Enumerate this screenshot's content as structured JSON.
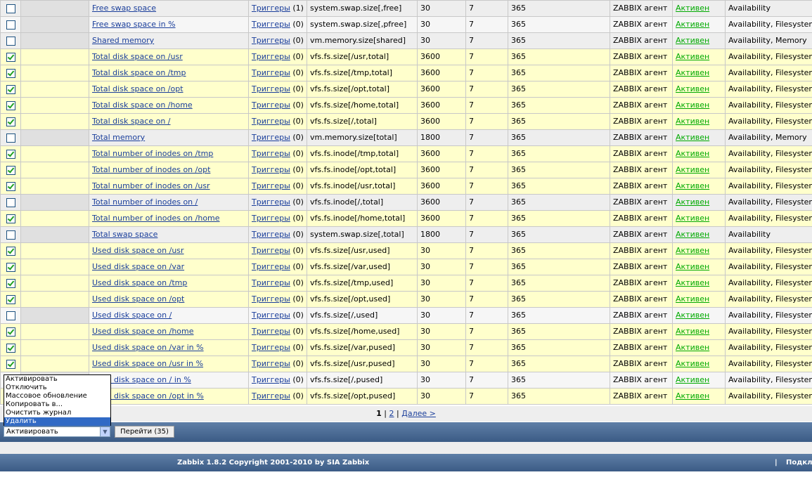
{
  "items": [
    {
      "checked": false,
      "name": "Free swap space",
      "triggers_label": "Триггеры",
      "triggers_count": "(1)",
      "key": "system.swap.size[,free]",
      "interval": "30",
      "history": "7",
      "trends": "365",
      "type": "ZABBIX агент",
      "status": "Активен",
      "applications": "Availability"
    },
    {
      "checked": false,
      "name": "Free swap space in %",
      "triggers_label": "Триггеры",
      "triggers_count": "(0)",
      "key": "system.swap.size[,pfree]",
      "interval": "30",
      "history": "7",
      "trends": "365",
      "type": "ZABBIX агент",
      "status": "Активен",
      "applications": "Availability, Filesystem"
    },
    {
      "checked": false,
      "name": "Shared memory",
      "triggers_label": "Триггеры",
      "triggers_count": "(0)",
      "key": "vm.memory.size[shared]",
      "interval": "30",
      "history": "7",
      "trends": "365",
      "type": "ZABBIX агент",
      "status": "Активен",
      "applications": "Availability, Memory"
    },
    {
      "checked": true,
      "name": "Total disk space on /usr",
      "triggers_label": "Триггеры",
      "triggers_count": "(0)",
      "key": "vfs.fs.size[/usr,total]",
      "interval": "3600",
      "history": "7",
      "trends": "365",
      "type": "ZABBIX агент",
      "status": "Активен",
      "applications": "Availability, Filesystem"
    },
    {
      "checked": true,
      "name": "Total disk space on /tmp",
      "triggers_label": "Триггеры",
      "triggers_count": "(0)",
      "key": "vfs.fs.size[/tmp,total]",
      "interval": "3600",
      "history": "7",
      "trends": "365",
      "type": "ZABBIX агент",
      "status": "Активен",
      "applications": "Availability, Filesystem"
    },
    {
      "checked": true,
      "name": "Total disk space on /opt",
      "triggers_label": "Триггеры",
      "triggers_count": "(0)",
      "key": "vfs.fs.size[/opt,total]",
      "interval": "3600",
      "history": "7",
      "trends": "365",
      "type": "ZABBIX агент",
      "status": "Активен",
      "applications": "Availability, Filesystem"
    },
    {
      "checked": true,
      "name": "Total disk space on /home",
      "triggers_label": "Триггеры",
      "triggers_count": "(0)",
      "key": "vfs.fs.size[/home,total]",
      "interval": "3600",
      "history": "7",
      "trends": "365",
      "type": "ZABBIX агент",
      "status": "Активен",
      "applications": "Availability, Filesystem"
    },
    {
      "checked": true,
      "name": "Total disk space on /",
      "triggers_label": "Триггеры",
      "triggers_count": "(0)",
      "key": "vfs.fs.size[/,total]",
      "interval": "3600",
      "history": "7",
      "trends": "365",
      "type": "ZABBIX агент",
      "status": "Активен",
      "applications": "Availability, Filesystem"
    },
    {
      "checked": false,
      "name": "Total memory",
      "triggers_label": "Триггеры",
      "triggers_count": "(0)",
      "key": "vm.memory.size[total]",
      "interval": "1800",
      "history": "7",
      "trends": "365",
      "type": "ZABBIX агент",
      "status": "Активен",
      "applications": "Availability, Memory"
    },
    {
      "checked": true,
      "name": "Total number of inodes on /tmp",
      "triggers_label": "Триггеры",
      "triggers_count": "(0)",
      "key": "vfs.fs.inode[/tmp,total]",
      "interval": "3600",
      "history": "7",
      "trends": "365",
      "type": "ZABBIX агент",
      "status": "Активен",
      "applications": "Availability, Filesystem"
    },
    {
      "checked": true,
      "name": "Total number of inodes on /opt",
      "triggers_label": "Триггеры",
      "triggers_count": "(0)",
      "key": "vfs.fs.inode[/opt,total]",
      "interval": "3600",
      "history": "7",
      "trends": "365",
      "type": "ZABBIX агент",
      "status": "Активен",
      "applications": "Availability, Filesystem"
    },
    {
      "checked": true,
      "name": "Total number of inodes on /usr",
      "triggers_label": "Триггеры",
      "triggers_count": "(0)",
      "key": "vfs.fs.inode[/usr,total]",
      "interval": "3600",
      "history": "7",
      "trends": "365",
      "type": "ZABBIX агент",
      "status": "Активен",
      "applications": "Availability, Filesystem"
    },
    {
      "checked": false,
      "name": "Total number of inodes on /",
      "triggers_label": "Триггеры",
      "triggers_count": "(0)",
      "key": "vfs.fs.inode[/,total]",
      "interval": "3600",
      "history": "7",
      "trends": "365",
      "type": "ZABBIX агент",
      "status": "Активен",
      "applications": "Availability, Filesystem"
    },
    {
      "checked": true,
      "name": "Total number of inodes on /home",
      "triggers_label": "Триггеры",
      "triggers_count": "(0)",
      "key": "vfs.fs.inode[/home,total]",
      "interval": "3600",
      "history": "7",
      "trends": "365",
      "type": "ZABBIX агент",
      "status": "Активен",
      "applications": "Availability, Filesystem"
    },
    {
      "checked": false,
      "name": "Total swap space",
      "triggers_label": "Триггеры",
      "triggers_count": "(0)",
      "key": "system.swap.size[,total]",
      "interval": "1800",
      "history": "7",
      "trends": "365",
      "type": "ZABBIX агент",
      "status": "Активен",
      "applications": "Availability"
    },
    {
      "checked": true,
      "name": "Used disk space on /usr",
      "triggers_label": "Триггеры",
      "triggers_count": "(0)",
      "key": "vfs.fs.size[/usr,used]",
      "interval": "30",
      "history": "7",
      "trends": "365",
      "type": "ZABBIX агент",
      "status": "Активен",
      "applications": "Availability, Filesystem"
    },
    {
      "checked": true,
      "name": "Used disk space on /var",
      "triggers_label": "Триггеры",
      "triggers_count": "(0)",
      "key": "vfs.fs.size[/var,used]",
      "interval": "30",
      "history": "7",
      "trends": "365",
      "type": "ZABBIX агент",
      "status": "Активен",
      "applications": "Availability, Filesystem"
    },
    {
      "checked": true,
      "name": "Used disk space on /tmp",
      "triggers_label": "Триггеры",
      "triggers_count": "(0)",
      "key": "vfs.fs.size[/tmp,used]",
      "interval": "30",
      "history": "7",
      "trends": "365",
      "type": "ZABBIX агент",
      "status": "Активен",
      "applications": "Availability, Filesystem"
    },
    {
      "checked": true,
      "name": "Used disk space on /opt",
      "triggers_label": "Триггеры",
      "triggers_count": "(0)",
      "key": "vfs.fs.size[/opt,used]",
      "interval": "30",
      "history": "7",
      "trends": "365",
      "type": "ZABBIX агент",
      "status": "Активен",
      "applications": "Availability, Filesystem"
    },
    {
      "checked": false,
      "name": "Used disk space on /",
      "triggers_label": "Триггеры",
      "triggers_count": "(0)",
      "key": "vfs.fs.size[/,used]",
      "interval": "30",
      "history": "7",
      "trends": "365",
      "type": "ZABBIX агент",
      "status": "Активен",
      "applications": "Availability, Filesystem"
    },
    {
      "checked": true,
      "name": "Used disk space on /home",
      "triggers_label": "Триггеры",
      "triggers_count": "(0)",
      "key": "vfs.fs.size[/home,used]",
      "interval": "30",
      "history": "7",
      "trends": "365",
      "type": "ZABBIX агент",
      "status": "Активен",
      "applications": "Availability, Filesystem"
    },
    {
      "checked": true,
      "name": "Used disk space on /var in %",
      "triggers_label": "Триггеры",
      "triggers_count": "(0)",
      "key": "vfs.fs.size[/var,pused]",
      "interval": "30",
      "history": "7",
      "trends": "365",
      "type": "ZABBIX агент",
      "status": "Активен",
      "applications": "Availability, Filesystem"
    },
    {
      "checked": true,
      "name": "Used disk space on /usr in %",
      "triggers_label": "Триггеры",
      "triggers_count": "(0)",
      "key": "vfs.fs.size[/usr,pused]",
      "interval": "30",
      "history": "7",
      "trends": "365",
      "type": "ZABBIX агент",
      "status": "Активен",
      "applications": "Availability, Filesystem"
    },
    {
      "checked": false,
      "name": "Used disk space on / in %",
      "triggers_label": "Триггеры",
      "triggers_count": "(0)",
      "key": "vfs.fs.size[/,pused]",
      "interval": "30",
      "history": "7",
      "trends": "365",
      "type": "ZABBIX агент",
      "status": "Активен",
      "applications": "Availability, Filesystem"
    },
    {
      "checked": true,
      "name": "Used disk space on /opt in %",
      "triggers_label": "Триггеры",
      "triggers_count": "(0)",
      "key": "vfs.fs.size[/opt,pused]",
      "interval": "30",
      "history": "7",
      "trends": "365",
      "type": "ZABBIX агент",
      "status": "Активен",
      "applications": "Availability, Filesystem"
    }
  ],
  "pager": {
    "current": "1",
    "sep1": "|",
    "page2": "2",
    "sep2": "|",
    "next": "Далее >"
  },
  "actions": {
    "options": [
      "Активировать",
      "Отключить",
      "Массовое обновление",
      "Копировать в...",
      "Очистить журнал",
      "Удалить"
    ],
    "highlighted_index": 5,
    "selected": "Активировать",
    "go_button": "Перейти (35)"
  },
  "footer": {
    "copyright": "Zabbix 1.8.2 Copyright 2001-2010 by SIA Zabbix",
    "separator": "|",
    "right": "Подключен как 'Admin'"
  },
  "colors": {
    "selected_row": "#ffffcc",
    "link": "#1a3e9b",
    "status_active": "#00aa00",
    "bar": "#3b5b85"
  }
}
